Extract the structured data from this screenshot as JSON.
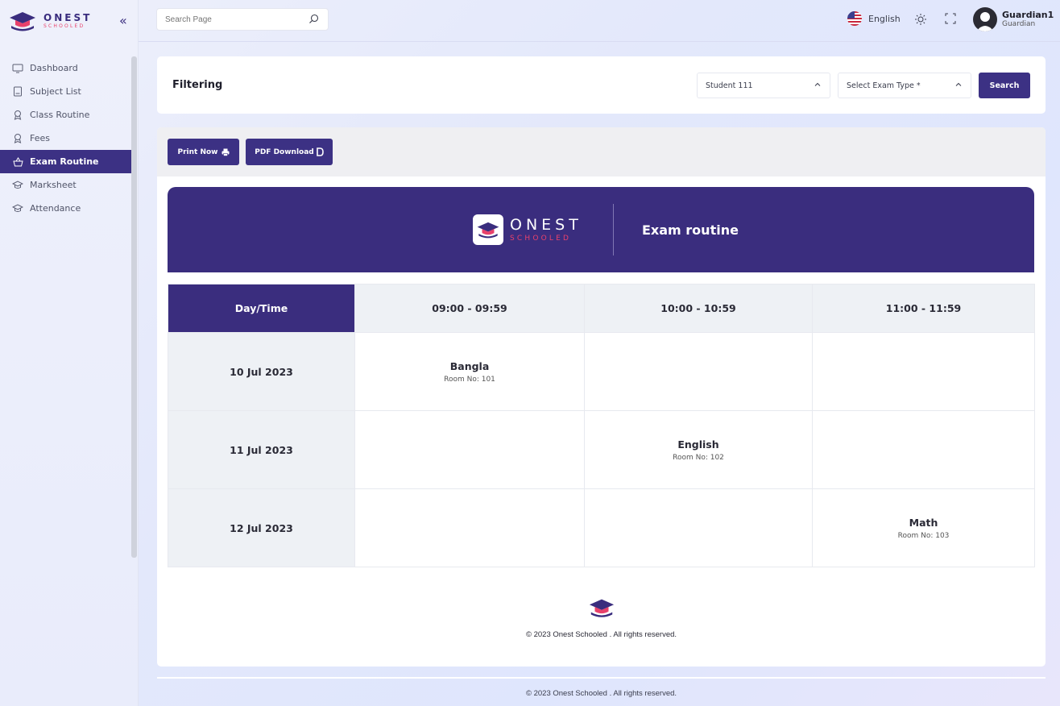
{
  "brand": {
    "name_top": "ONEST",
    "name_bottom": "SCHOOLED",
    "accent": "#3a2d7e",
    "pink": "#e8416b"
  },
  "sidebar": {
    "collapse_icon": "double-chevron-left-icon",
    "items": [
      {
        "label": "Dashboard",
        "icon": "monitor-icon",
        "active": false
      },
      {
        "label": "Subject List",
        "icon": "book-icon",
        "active": false
      },
      {
        "label": "Class Routine",
        "icon": "award-icon",
        "active": false
      },
      {
        "label": "Fees",
        "icon": "award-icon",
        "active": false
      },
      {
        "label": "Exam Routine",
        "icon": "basket-icon",
        "active": true
      },
      {
        "label": "Marksheet",
        "icon": "graduation-cap-icon",
        "active": false
      },
      {
        "label": "Attendance",
        "icon": "graduation-cap-icon",
        "active": false
      }
    ]
  },
  "topbar": {
    "search_placeholder": "Search Page",
    "language": "English",
    "user": {
      "name": "Guardian1",
      "role": "Guardian"
    }
  },
  "filter": {
    "title": "Filtering",
    "student_value": "Student 111",
    "exam_type_placeholder": "Select Exam Type *",
    "search_label": "Search"
  },
  "actions": {
    "print_label": "Print Now",
    "pdf_label": "PDF Download"
  },
  "routine": {
    "title": "Exam routine",
    "header_label": "Day/Time",
    "time_slots": [
      "09:00 - 09:59",
      "10:00 - 10:59",
      "11:00 - 11:59"
    ],
    "rows": [
      {
        "date": "10 Jul 2023",
        "cells": [
          {
            "subject": "Bangla",
            "room": "Room No: 101"
          },
          null,
          null
        ]
      },
      {
        "date": "11 Jul 2023",
        "cells": [
          null,
          {
            "subject": "English",
            "room": "Room No: 102"
          },
          null
        ]
      },
      {
        "date": "12 Jul 2023",
        "cells": [
          null,
          null,
          {
            "subject": "Math",
            "room": "Room No: 103"
          }
        ]
      }
    ]
  },
  "footer": {
    "panel_copyright": "© 2023 Onest Schooled . All rights reserved.",
    "page_copyright": "© 2023 Onest Schooled . All rights reserved."
  }
}
